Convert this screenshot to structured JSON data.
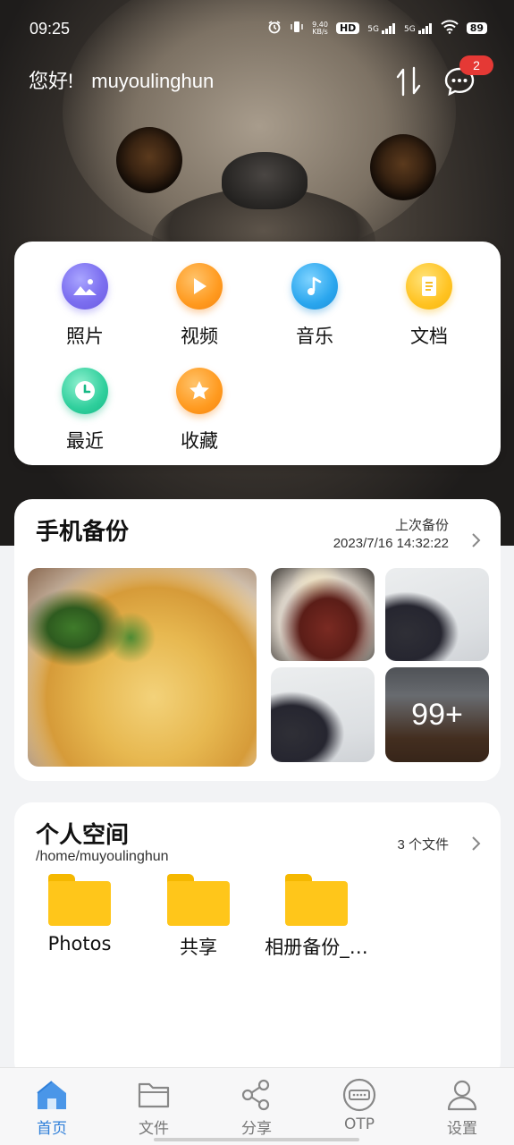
{
  "status_bar": {
    "time": "09:25",
    "net_speed_top": "9.40",
    "net_speed_unit": "KB/s",
    "hd_label": "HD",
    "sim1_label": "5G",
    "sim2_label": "5G",
    "battery": "89"
  },
  "header": {
    "greeting": "您好!",
    "username": "muyoulinghun",
    "message_badge": "2"
  },
  "categories": [
    {
      "label": "照片",
      "icon": "photo-icon"
    },
    {
      "label": "视频",
      "icon": "play-icon"
    },
    {
      "label": "音乐",
      "icon": "music-note-icon"
    },
    {
      "label": "文档",
      "icon": "document-icon"
    },
    {
      "label": "最近",
      "icon": "clock-icon"
    },
    {
      "label": "收藏",
      "icon": "star-icon"
    }
  ],
  "backup": {
    "title": "手机备份",
    "last_label": "上次备份",
    "last_time": "2023/7/16 14:32:22",
    "more_count": "99+"
  },
  "space": {
    "title": "个人空间",
    "path": "/home/muyoulinghun",
    "file_count": "3 个文件",
    "folders": [
      {
        "name": "Photos"
      },
      {
        "name": "共享"
      },
      {
        "name": "相册备份_…"
      }
    ]
  },
  "nav": [
    {
      "label": "首页",
      "icon": "home-icon",
      "active": true
    },
    {
      "label": "文件",
      "icon": "folder-icon",
      "active": false
    },
    {
      "label": "分享",
      "icon": "share-icon",
      "active": false
    },
    {
      "label": "OTP",
      "icon": "otp-icon",
      "active": false
    },
    {
      "label": "设置",
      "icon": "user-icon",
      "active": false
    }
  ],
  "colors": {
    "accent": "#2f7fd9",
    "badge": "#e53935",
    "folder": "#ffc61a"
  }
}
